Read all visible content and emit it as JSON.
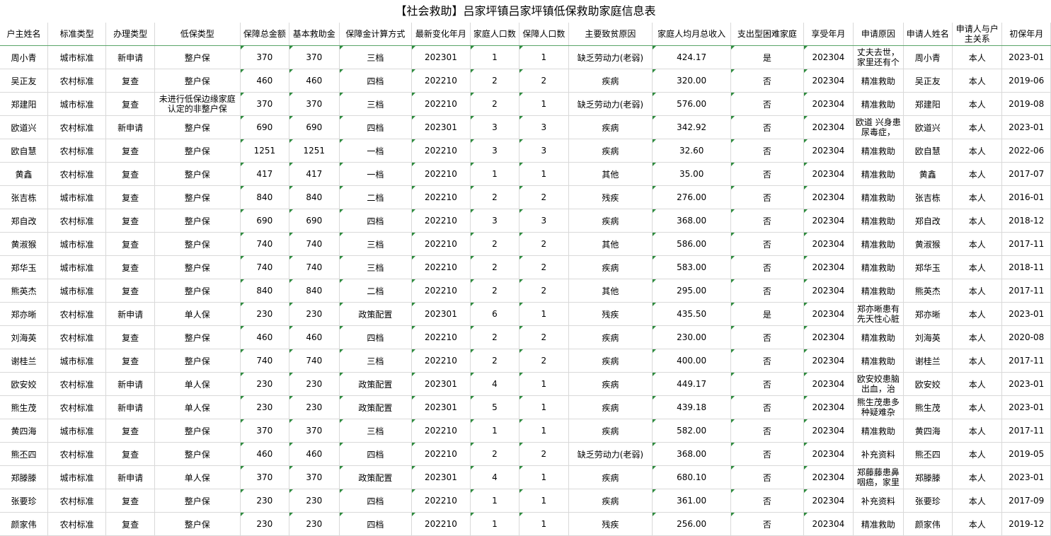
{
  "title": "【社会救助】吕家坪镇吕家坪镇低保救助家庭信息表",
  "columns": [
    "户主姓名",
    "标准类型",
    "办理类型",
    "低保类型",
    "保障总金额",
    "基本救助金",
    "保障金计算方式",
    "最新变化年月",
    "家庭人口数",
    "保障人口数",
    "主要致贫原因",
    "家庭人均月总收入",
    "支出型困难家庭",
    "享受年月",
    "申请原因",
    "申请人姓名",
    "申请人与户主关系",
    "初保年月"
  ],
  "rows": [
    [
      "周小青",
      "城市标准",
      "新申请",
      "整户保",
      "370",
      "370",
      "三档",
      "202301",
      "1",
      "1",
      "缺乏劳动力(老弱)",
      "424.17",
      "是",
      "202304",
      "丈夫去世，家里还有个",
      "周小青",
      "本人",
      "2023-01"
    ],
    [
      "吴正友",
      "农村标准",
      "复查",
      "整户保",
      "460",
      "460",
      "四档",
      "202210",
      "2",
      "2",
      "疾病",
      "320.00",
      "否",
      "202304",
      "精准救助",
      "吴正友",
      "本人",
      "2019-06"
    ],
    [
      "郑建阳",
      "城市标准",
      "复查",
      "未进行低保边缘家庭认定的非整户保",
      "370",
      "370",
      "三档",
      "202210",
      "2",
      "1",
      "缺乏劳动力(老弱)",
      "576.00",
      "否",
      "202304",
      "精准救助",
      "郑建阳",
      "本人",
      "2019-08"
    ],
    [
      "欧道兴",
      "农村标准",
      "新申请",
      "整户保",
      "690",
      "690",
      "四档",
      "202301",
      "3",
      "3",
      "疾病",
      "342.92",
      "否",
      "202304",
      "欧道 兴身患尿毒症，",
      "欧道兴",
      "本人",
      "2023-01"
    ],
    [
      "欧自慧",
      "农村标准",
      "复查",
      "整户保",
      "1251",
      "1251",
      "一档",
      "202210",
      "3",
      "3",
      "疾病",
      "32.60",
      "否",
      "202304",
      "精准救助",
      "欧自慧",
      "本人",
      "2022-06"
    ],
    [
      "黄鑫",
      "农村标准",
      "复查",
      "整户保",
      "417",
      "417",
      "一档",
      "202210",
      "1",
      "1",
      "其他",
      "35.00",
      "否",
      "202304",
      "精准救助",
      "黄鑫",
      "本人",
      "2017-07"
    ],
    [
      "张吉栋",
      "城市标准",
      "复查",
      "整户保",
      "840",
      "840",
      "二档",
      "202210",
      "2",
      "2",
      "残疾",
      "276.00",
      "否",
      "202304",
      "精准救助",
      "张吉栋",
      "本人",
      "2016-01"
    ],
    [
      "郑自改",
      "农村标准",
      "复查",
      "整户保",
      "690",
      "690",
      "四档",
      "202210",
      "3",
      "3",
      "疾病",
      "368.00",
      "否",
      "202304",
      "精准救助",
      "郑自改",
      "本人",
      "2018-12"
    ],
    [
      "黄淑猴",
      "城市标准",
      "复查",
      "整户保",
      "740",
      "740",
      "三档",
      "202210",
      "2",
      "2",
      "其他",
      "586.00",
      "否",
      "202304",
      "精准救助",
      "黄淑猴",
      "本人",
      "2017-11"
    ],
    [
      "郑华玉",
      "城市标准",
      "复查",
      "整户保",
      "740",
      "740",
      "三档",
      "202210",
      "2",
      "2",
      "疾病",
      "583.00",
      "否",
      "202304",
      "精准救助",
      "郑华玉",
      "本人",
      "2018-11"
    ],
    [
      "熊英杰",
      "城市标准",
      "复查",
      "整户保",
      "840",
      "840",
      "二档",
      "202210",
      "2",
      "2",
      "其他",
      "295.00",
      "否",
      "202304",
      "精准救助",
      "熊英杰",
      "本人",
      "2017-11"
    ],
    [
      "郑亦晰",
      "农村标准",
      "新申请",
      "单人保",
      "230",
      "230",
      "政策配置",
      "202301",
      "6",
      "1",
      "残疾",
      "435.50",
      "是",
      "202304",
      "郑亦晰患有先天性心脏",
      "郑亦晰",
      "本人",
      "2023-01"
    ],
    [
      "刘海英",
      "农村标准",
      "复查",
      "整户保",
      "460",
      "460",
      "四档",
      "202210",
      "2",
      "2",
      "疾病",
      "230.00",
      "否",
      "202304",
      "精准救助",
      "刘海英",
      "本人",
      "2020-08"
    ],
    [
      "谢桂兰",
      "城市标准",
      "复查",
      "整户保",
      "740",
      "740",
      "三档",
      "202210",
      "2",
      "2",
      "疾病",
      "400.00",
      "否",
      "202304",
      "精准救助",
      "谢桂兰",
      "本人",
      "2017-11"
    ],
    [
      "欧安姣",
      "农村标准",
      "新申请",
      "单人保",
      "230",
      "230",
      "政策配置",
      "202301",
      "4",
      "1",
      "疾病",
      "449.17",
      "否",
      "202304",
      "欧安姣患脑出血，治",
      "欧安姣",
      "本人",
      "2023-01"
    ],
    [
      "熊生茂",
      "农村标准",
      "新申请",
      "单人保",
      "230",
      "230",
      "政策配置",
      "202301",
      "5",
      "1",
      "疾病",
      "439.18",
      "否",
      "202304",
      "熊生茂患多种疑难杂",
      "熊生茂",
      "本人",
      "2023-01"
    ],
    [
      "黄四海",
      "城市标准",
      "复查",
      "整户保",
      "370",
      "370",
      "三档",
      "202210",
      "1",
      "1",
      "疾病",
      "582.00",
      "否",
      "202304",
      "精准救助",
      "黄四海",
      "本人",
      "2017-11"
    ],
    [
      "熊丕四",
      "农村标准",
      "复查",
      "整户保",
      "460",
      "460",
      "四档",
      "202210",
      "2",
      "2",
      "缺乏劳动力(老弱)",
      "368.00",
      "否",
      "202304",
      "补充资料",
      "熊丕四",
      "本人",
      "2019-05"
    ],
    [
      "郑滕滕",
      "城市标准",
      "新申请",
      "单人保",
      "370",
      "370",
      "政策配置",
      "202301",
      "4",
      "1",
      "疾病",
      "680.10",
      "否",
      "202304",
      "郑藤藤患鼻咽癌，家里",
      "郑滕滕",
      "本人",
      "2023-01"
    ],
    [
      "张要珍",
      "农村标准",
      "复查",
      "整户保",
      "230",
      "230",
      "四档",
      "202210",
      "1",
      "1",
      "疾病",
      "361.00",
      "否",
      "202304",
      "补充资料",
      "张要珍",
      "本人",
      "2017-09"
    ],
    [
      "颜家伟",
      "农村标准",
      "复查",
      "整户保",
      "230",
      "230",
      "四档",
      "202210",
      "1",
      "1",
      "残疾",
      "256.00",
      "否",
      "202304",
      "精准救助",
      "颜家伟",
      "本人",
      "2019-12"
    ]
  ]
}
